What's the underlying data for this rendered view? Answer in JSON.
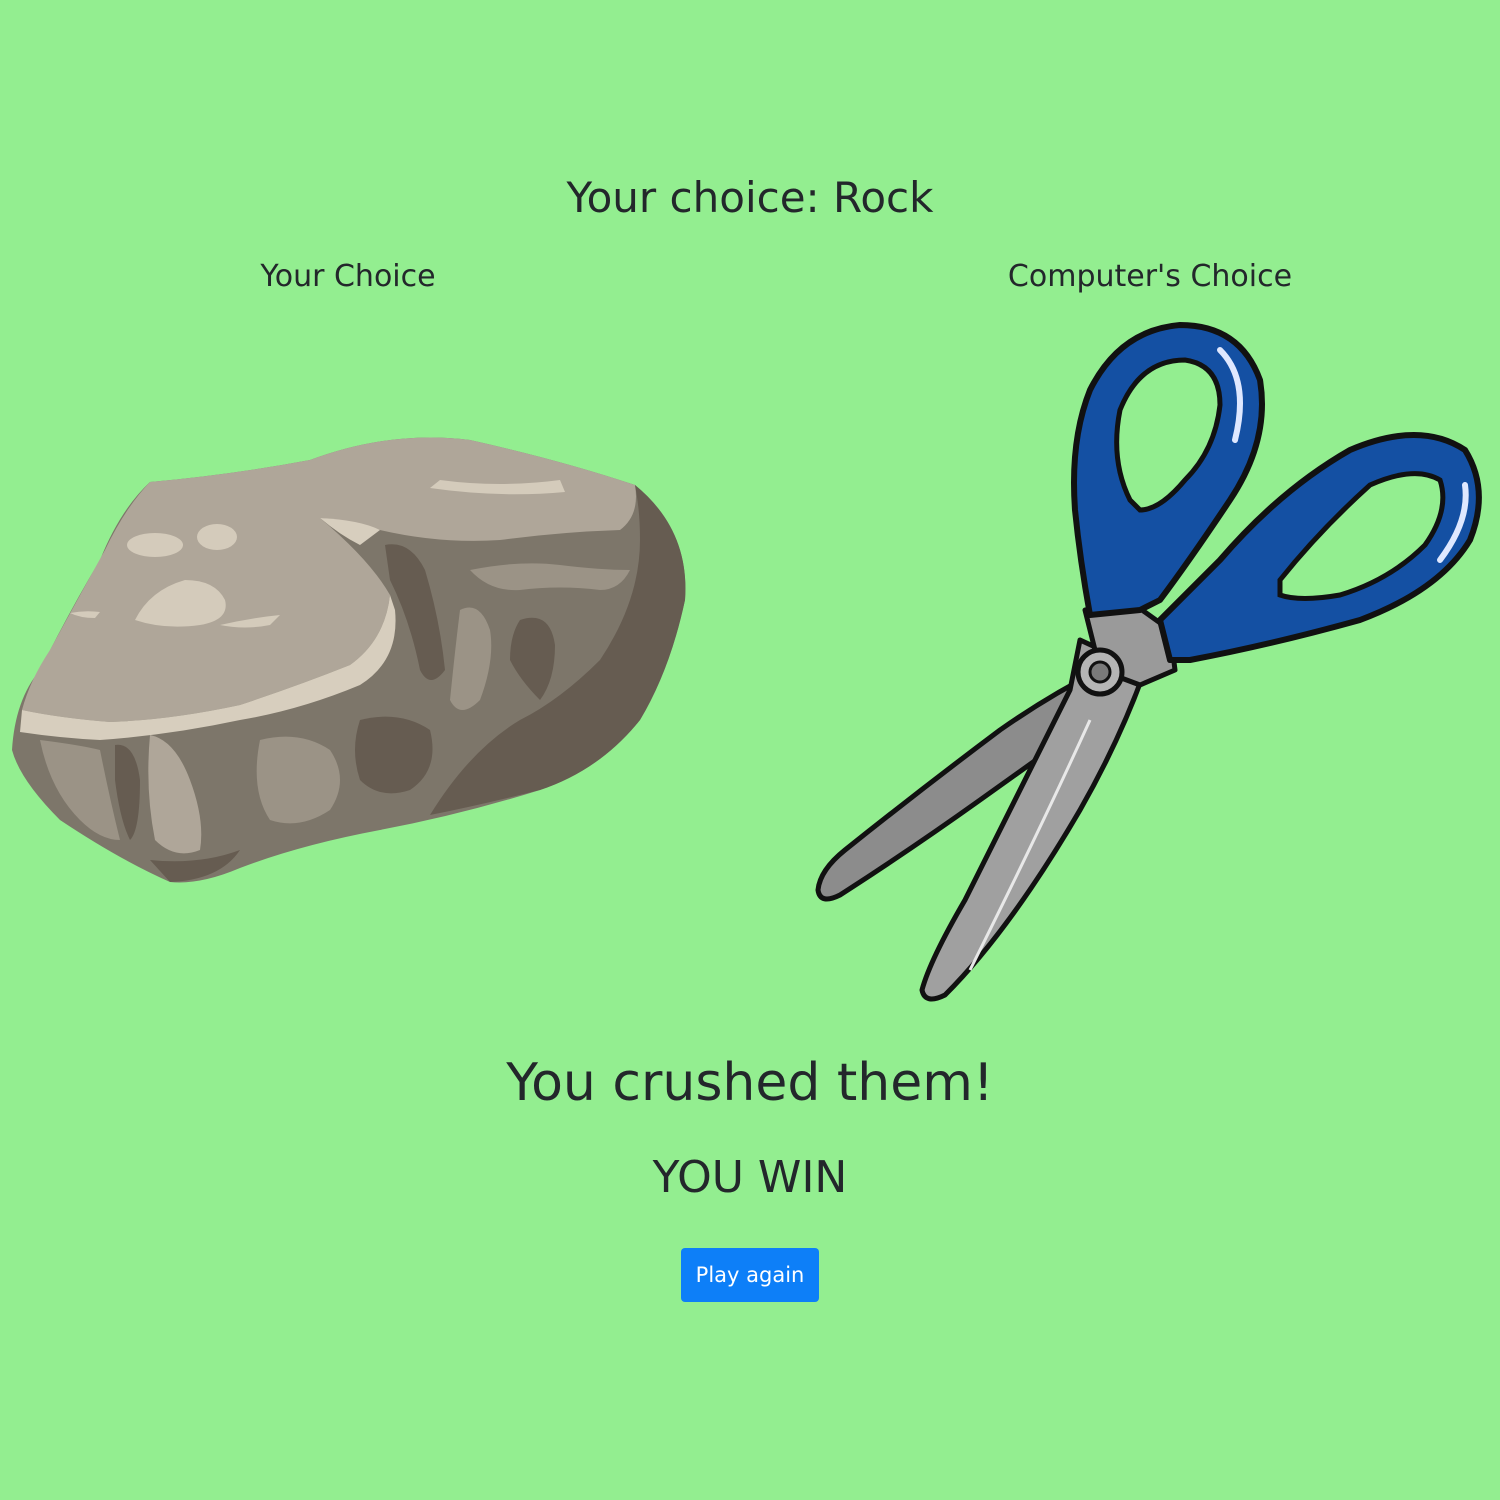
{
  "headline": "Your choice: Rock",
  "player": {
    "label": "Your Choice",
    "choice_icon": "rock-icon"
  },
  "computer": {
    "label": "Computer's Choice",
    "choice_icon": "scissors-icon"
  },
  "result": {
    "message": "You crushed them!",
    "outcome": "YOU WIN"
  },
  "actions": {
    "play_again_label": "Play again"
  },
  "colors": {
    "background": "#93ee90",
    "text": "#23272b",
    "button": "#0d7ff8",
    "scissors_handle": "#1450a3",
    "rock": "#8a8275"
  }
}
